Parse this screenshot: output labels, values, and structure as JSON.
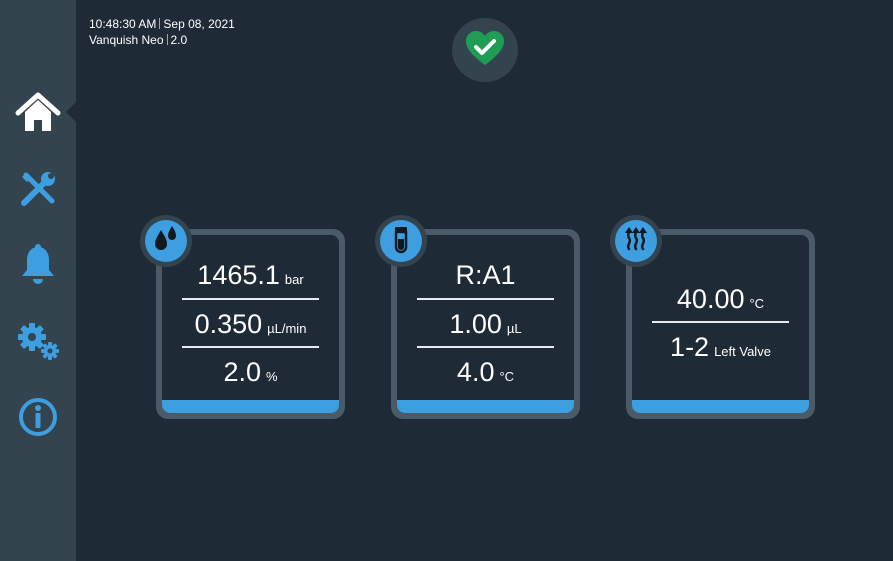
{
  "header": {
    "time": "10:48:30 AM",
    "date": "Sep 08, 2021",
    "instrument": "Vanquish Neo",
    "version": "2.0"
  },
  "status": {
    "icon": "heart-check-icon",
    "color": "#1f9d55"
  },
  "sidebar": {
    "items": [
      {
        "name": "home",
        "icon": "home-icon",
        "active": true
      },
      {
        "name": "tools",
        "icon": "wrench-screwdriver-icon"
      },
      {
        "name": "alarms",
        "icon": "bell-icon"
      },
      {
        "name": "settings",
        "icon": "gears-icon"
      },
      {
        "name": "info",
        "icon": "info-icon"
      }
    ]
  },
  "colors": {
    "accent": "#3d9ee0",
    "background": "#1e2b36",
    "sidebar": "#34444f"
  },
  "tiles": {
    "pump": {
      "icon": "drops-icon",
      "pressure": {
        "value": "1465.1",
        "unit": "bar"
      },
      "flow": {
        "value": "0.350",
        "unit": "µL/min"
      },
      "composition": {
        "value": "2.0",
        "unit": "%"
      }
    },
    "autosampler": {
      "icon": "vial-icon",
      "position": {
        "value": "R:A1"
      },
      "volume": {
        "value": "1.00",
        "unit": "µL"
      },
      "temperature": {
        "value": "4.0",
        "unit": "°C"
      }
    },
    "column": {
      "icon": "heat-icon",
      "temperature": {
        "value": "40.00",
        "unit": "°C"
      },
      "valve": {
        "value": "1-2",
        "unit": "Left Valve"
      }
    }
  }
}
